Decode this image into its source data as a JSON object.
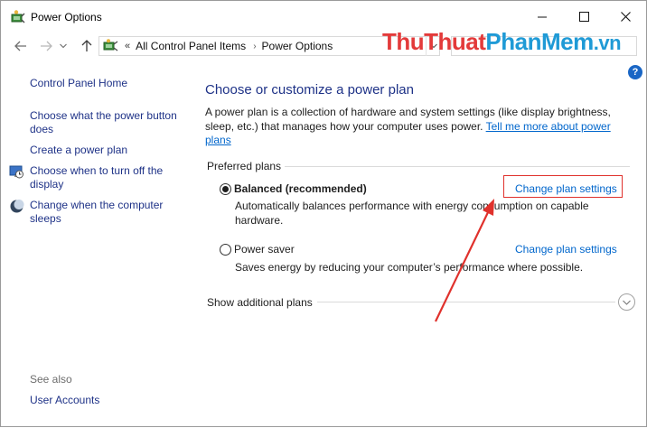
{
  "window": {
    "title": "Power Options",
    "minimize_glyph": "—",
    "maximize_glyph": "☐",
    "close_glyph": "✕"
  },
  "navbar": {
    "back_icon": "arrow-left-icon",
    "forward_icon": "arrow-right-icon",
    "recent_icon": "chevron-down-icon",
    "up_icon": "arrow-up-icon",
    "address_chevron": "«",
    "breadcrumbs": [
      "All Control Panel Items",
      "Power Options"
    ],
    "separator": "›"
  },
  "watermark": {
    "part1": "ThuThuat",
    "part2": "PhanMem",
    "part3": ".vn"
  },
  "help": {
    "label": "?"
  },
  "sidebar": {
    "home": "Control Panel Home",
    "items": [
      {
        "label": "Choose what the power button does",
        "icon": ""
      },
      {
        "label": "Create a power plan",
        "icon": ""
      },
      {
        "label": "Choose when to turn off the display",
        "icon": "display-clock-icon"
      },
      {
        "label": "Change when the computer sleeps",
        "icon": "moon-icon"
      }
    ],
    "see_also": "See also",
    "user_accounts": "User Accounts"
  },
  "main": {
    "title": "Choose or customize a power plan",
    "description": "A power plan is a collection of hardware and system settings (like display brightness, sleep, etc.) that manages how your computer uses power.",
    "learn_more": "Tell me more about power plans",
    "preferred_label": "Preferred plans",
    "plans": [
      {
        "name": "Balanced (recommended)",
        "selected": true,
        "description": "Automatically balances performance with energy consumption on capable hardware.",
        "change_label": "Change plan settings"
      },
      {
        "name": "Power saver",
        "selected": false,
        "description": "Saves energy by reducing your computer’s performance where possible.",
        "change_label": "Change plan settings"
      }
    ],
    "additional_plans": "Show additional plans"
  },
  "colors": {
    "link": "#0066cc",
    "heading": "#1e3287",
    "annotation": "#e0312c"
  }
}
